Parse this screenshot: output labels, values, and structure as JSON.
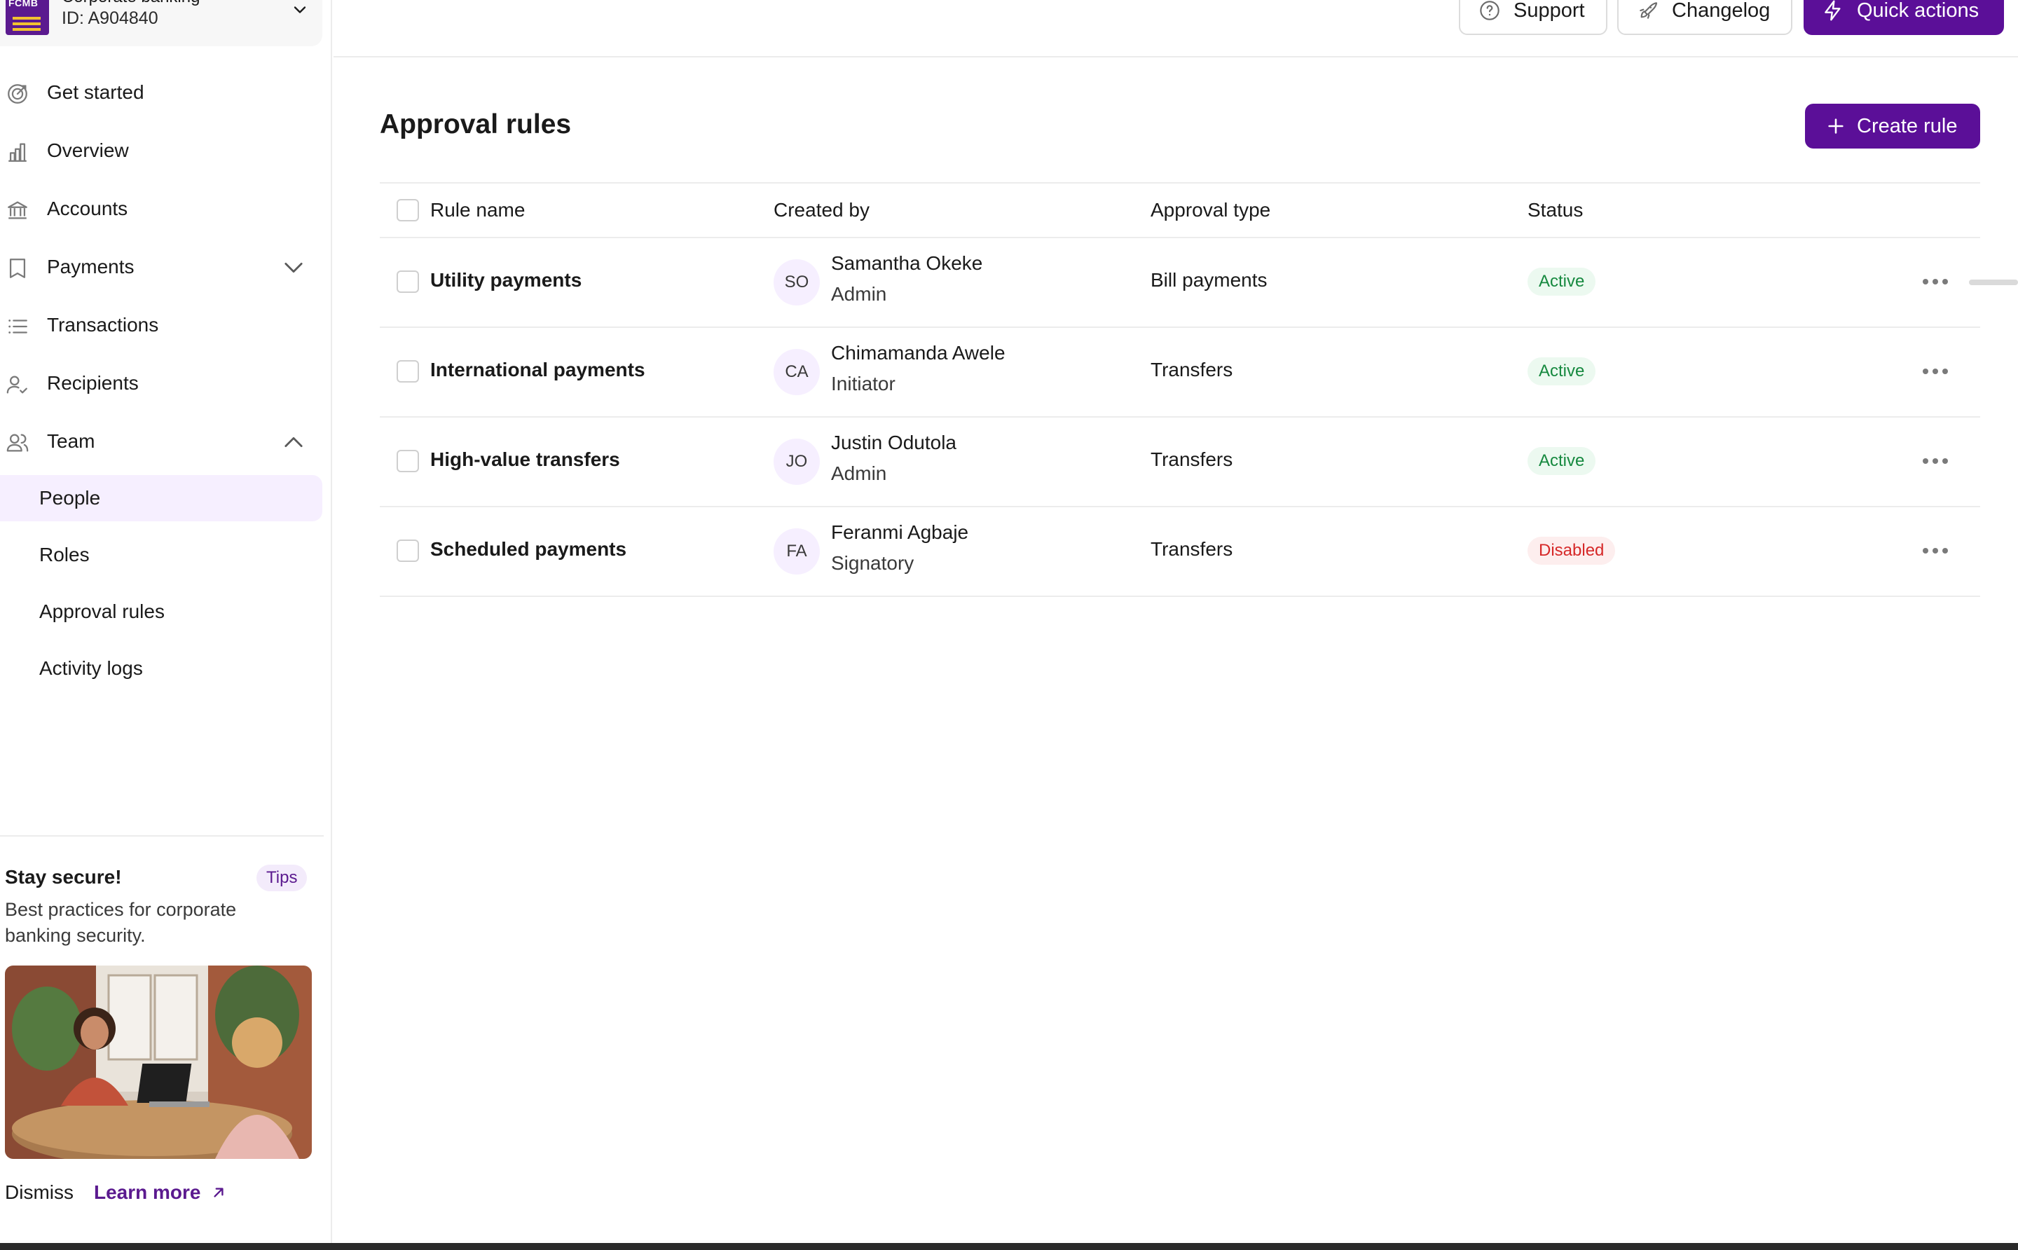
{
  "org": {
    "logo_text": "FCMB",
    "name": "Corporate banking",
    "id": "ID: A904840"
  },
  "nav": [
    {
      "label": "Get started",
      "icon": "target-icon"
    },
    {
      "label": "Overview",
      "icon": "bar-chart-icon"
    },
    {
      "label": "Accounts",
      "icon": "bank-icon"
    },
    {
      "label": "Payments",
      "icon": "receipt-icon",
      "expanded": false
    },
    {
      "label": "Transactions",
      "icon": "list-icon"
    },
    {
      "label": "Recipients",
      "icon": "users-check-icon"
    },
    {
      "label": "Team",
      "icon": "team-icon",
      "expanded": true
    }
  ],
  "team_sub": [
    {
      "label": "People",
      "active": true
    },
    {
      "label": "Roles",
      "active": false
    },
    {
      "label": "Approval rules",
      "active": false
    },
    {
      "label": "Activity logs",
      "active": false
    }
  ],
  "tip": {
    "title": "Stay secure!",
    "badge": "Tips",
    "description": "Best practices for corporate banking security.",
    "dismiss": "Dismiss",
    "learn_more": "Learn more"
  },
  "header": {
    "support": "Support",
    "changelog": "Changelog",
    "quick_actions": "Quick actions"
  },
  "page": {
    "title": "Approval rules",
    "create_button": "Create rule"
  },
  "table": {
    "columns": [
      "Rule name",
      "Created by",
      "Approval type",
      "Status"
    ],
    "rows": [
      {
        "rule": "Utility payments",
        "initials": "SO",
        "creator": "Samantha Okeke",
        "role": "Admin",
        "type": "Bill payments",
        "status": "Active"
      },
      {
        "rule": "International payments",
        "initials": "CA",
        "creator": "Chimamanda Awele",
        "role": "Initiator",
        "type": "Transfers",
        "status": "Active"
      },
      {
        "rule": "High-value transfers",
        "initials": "JO",
        "creator": "Justin Odutola",
        "role": "Admin",
        "type": "Transfers",
        "status": "Active"
      },
      {
        "rule": "Scheduled payments",
        "initials": "FA",
        "creator": "Feranmi Agbaje",
        "role": "Signatory",
        "type": "Transfers",
        "status": "Disabled"
      }
    ]
  },
  "colors": {
    "brand": "#5b0f98",
    "active_bg": "#f6efff",
    "status_active": "#16893f",
    "status_disabled": "#d62828"
  }
}
